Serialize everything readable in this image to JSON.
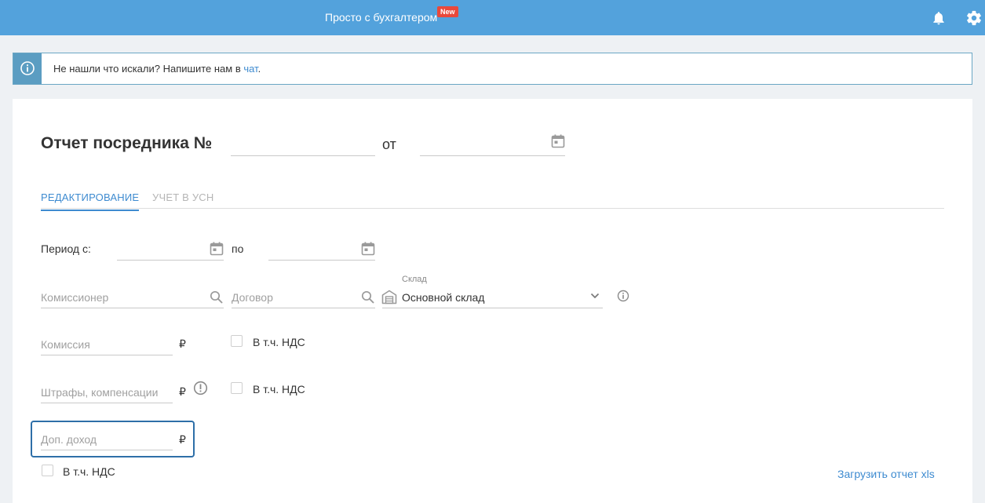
{
  "header": {
    "title": "Просто с бухгалтером",
    "badge": "New",
    "icons": [
      "bell-icon",
      "gear-icon"
    ]
  },
  "info": {
    "text": "Не нашли что искали? Напишите нам в ",
    "link": "чат",
    "suffix": "."
  },
  "form": {
    "title": "Отчет посредника №",
    "number_value": "",
    "from_label": "от",
    "date_value": "",
    "tabs": [
      {
        "label": "РЕДАКТИРОВАНИЕ",
        "active": true
      },
      {
        "label": "УЧЕТ В УСН",
        "active": false
      }
    ],
    "period_from_label": "Период с:",
    "period_to_label": "по",
    "period_from_value": "",
    "period_to_value": "",
    "commissioner_placeholder": "Комиссионер",
    "contract_placeholder": "Договор",
    "warehouse_label": "Склад",
    "warehouse_value": "Основной склад",
    "commission_placeholder": "Комиссия",
    "fines_placeholder": "Штрафы, компенсации",
    "extra_income_placeholder": "Доп. доход",
    "currency": "₽",
    "vat_label": "В т.ч. НДС",
    "upload_link": "Загрузить отчет xls"
  },
  "colors": {
    "header_bg": "#53a2dc",
    "accent": "#3e8bd0",
    "badge": "#e9493b",
    "focus_border": "#2e6fa8"
  }
}
